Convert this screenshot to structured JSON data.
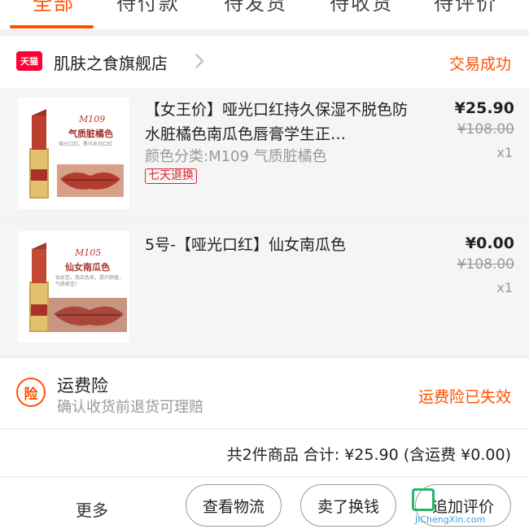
{
  "tabs": [
    {
      "label": "全部",
      "active": true
    },
    {
      "label": "待付款",
      "active": false
    },
    {
      "label": "待发货",
      "active": false
    },
    {
      "label": "待收货",
      "active": false
    },
    {
      "label": "待评价",
      "active": false
    }
  ],
  "shop": {
    "badge": "天猫",
    "name": "肌肤之食旗舰店",
    "status": "交易成功"
  },
  "items": [
    {
      "thumb_code": "M109",
      "thumb_name": "气质脏橘色",
      "thumb_desc": "哑光口红，黑马系列口红",
      "title": "【女王价】哑光口红持久保湿不脱色防水脏橘色南瓜色唇膏学生正…",
      "sku": "颜色分类:M109 气质脏橘色",
      "tag": "七天退换",
      "price": "¥25.90",
      "orig_price": "¥108.00",
      "qty": "x1"
    },
    {
      "thumb_code": "M105",
      "thumb_name": "仙女南瓜色",
      "thumb_desc": "仙女范，南瓜色系，提升颜值，气质绝佳！",
      "title": "5号-【哑光口红】仙女南瓜色",
      "price": "¥0.00",
      "orig_price": "¥108.00",
      "qty": "x1"
    }
  ],
  "insurance": {
    "icon_text": "险",
    "title": "运费险",
    "subtitle": "确认收货前退货可理赔",
    "status": "运费险已失效"
  },
  "summary": {
    "text": "共2件商品  合计: ¥25.90 (含运费 ¥0.00)"
  },
  "actions": {
    "more": "更多",
    "logistics": "查看物流",
    "resell": "卖了换钱",
    "review": "追加评价"
  },
  "watermark": {
    "text": "JiChengXin.com"
  },
  "colors": {
    "accent": "#ff5000",
    "tmall_red": "#ff0036",
    "tag_red": "#dd2233",
    "lipstick": "#b8402c"
  }
}
